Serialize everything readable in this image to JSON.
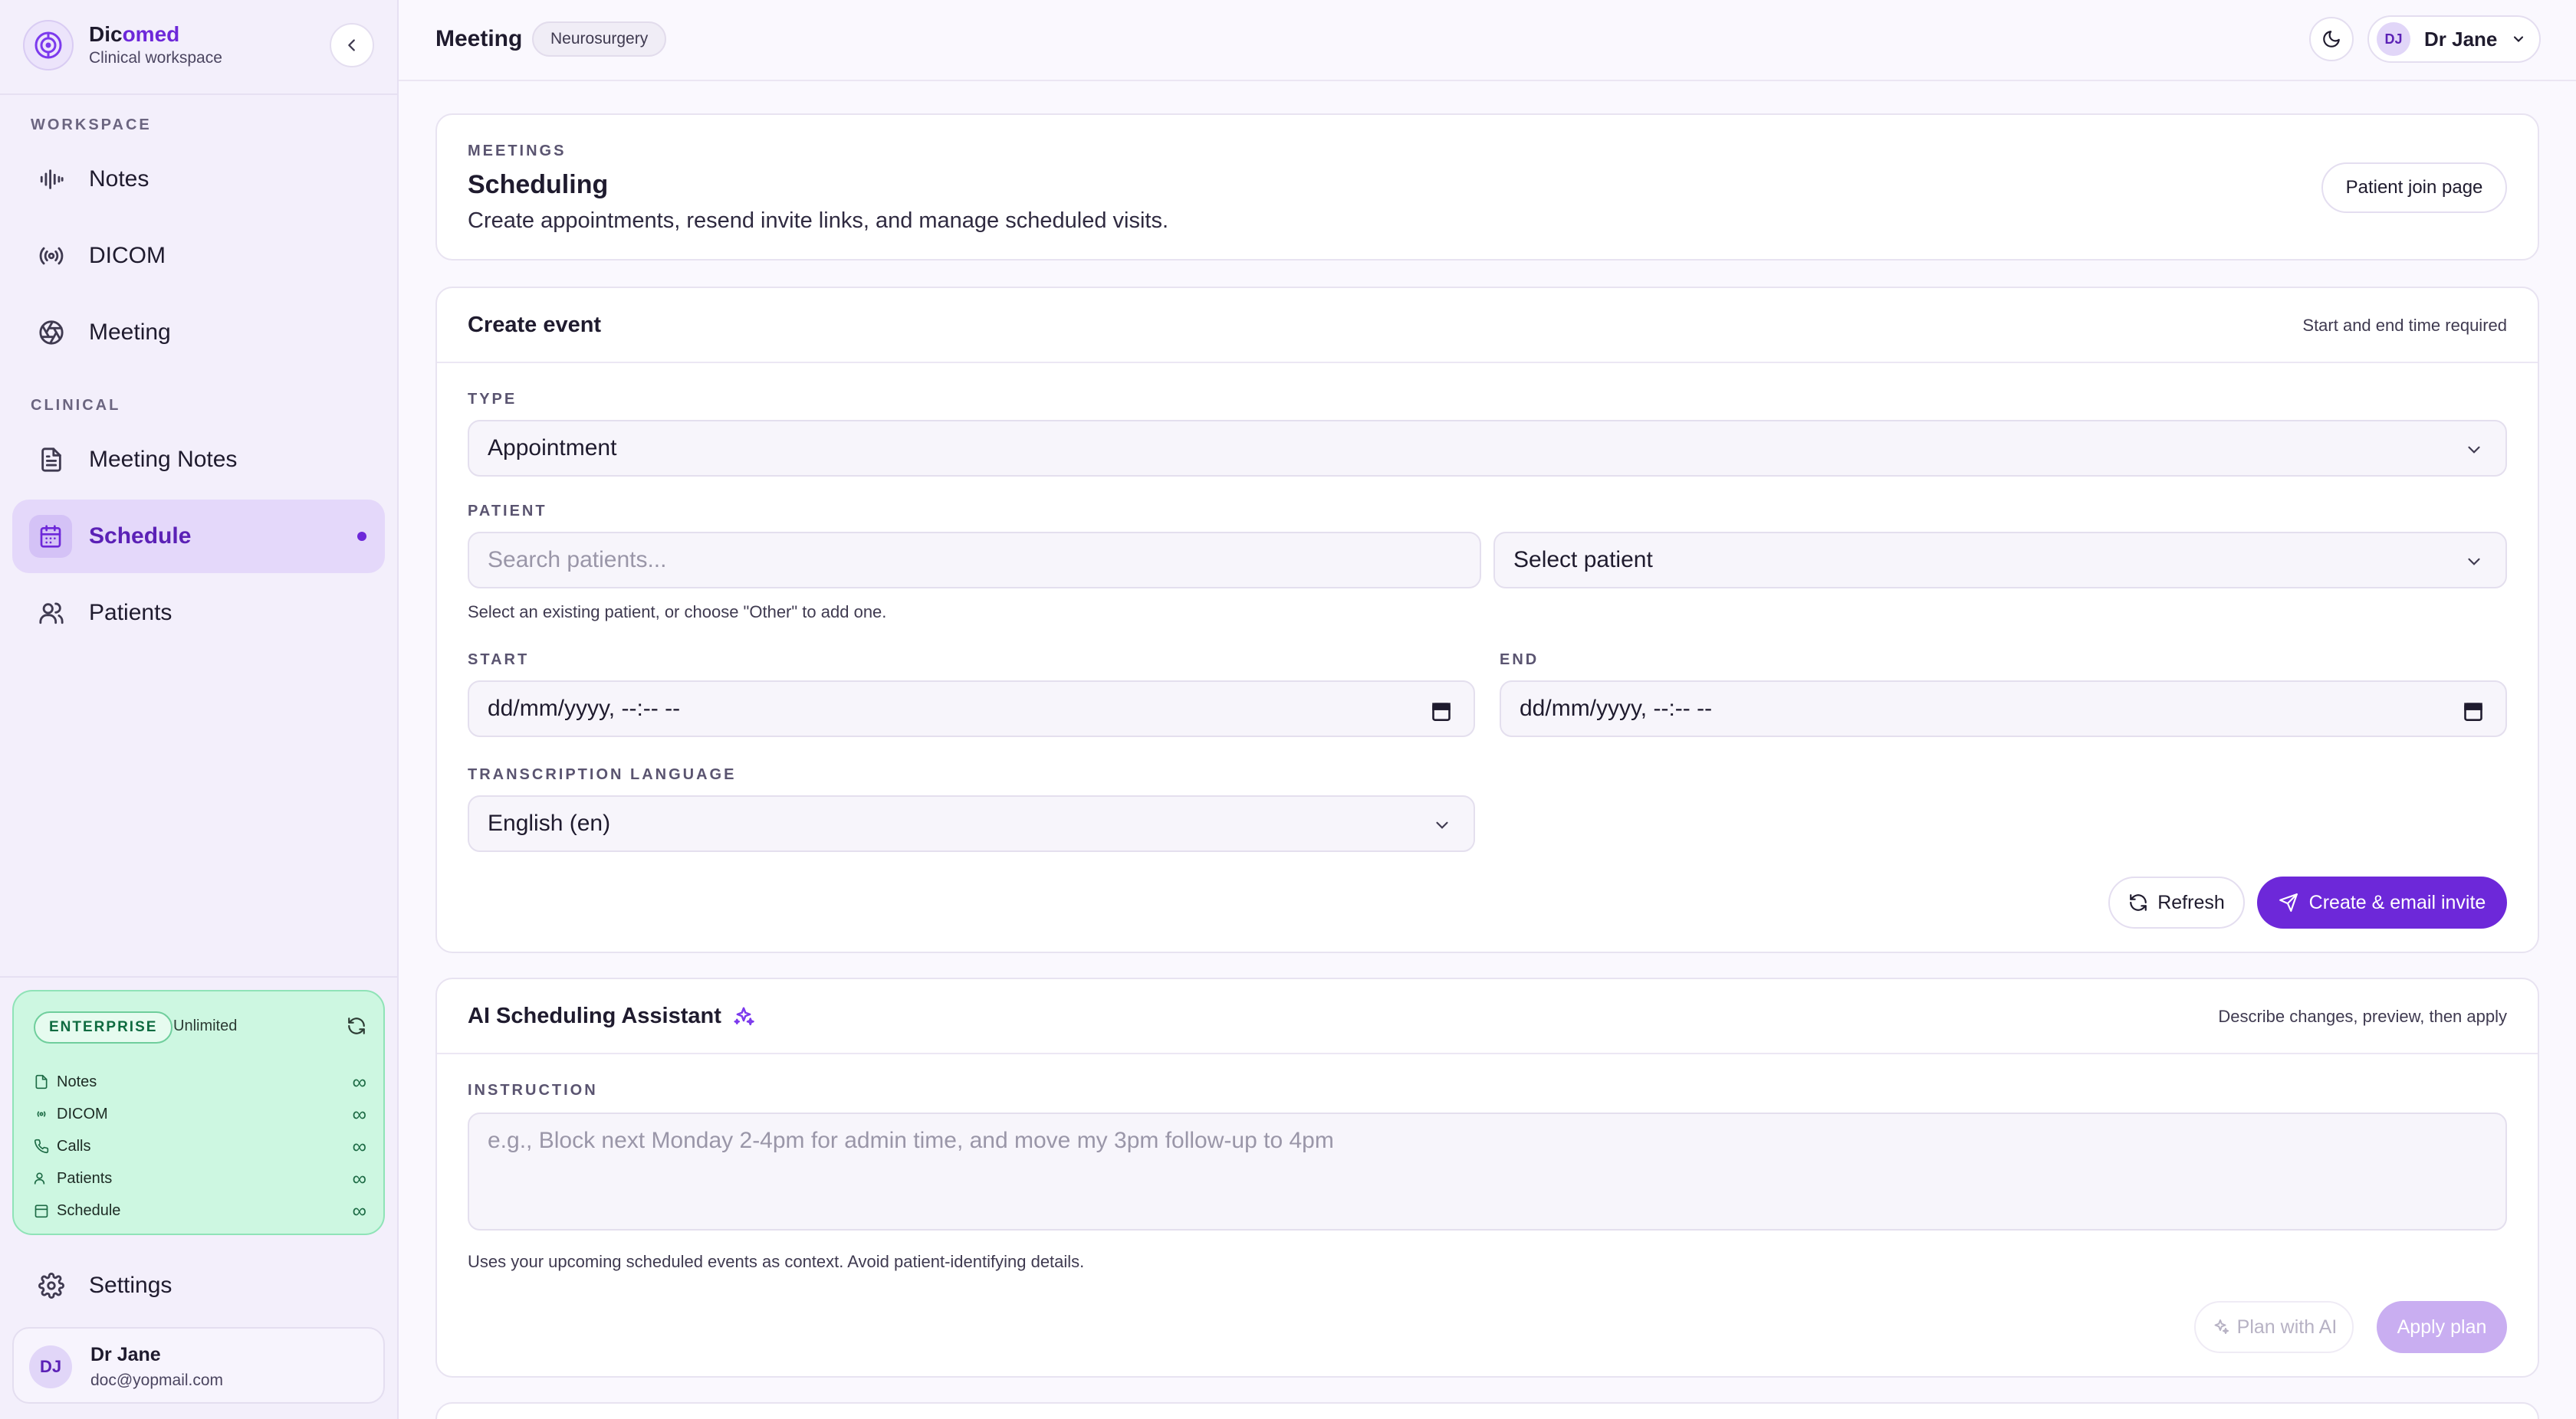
{
  "brand": {
    "name_part1": "Dic",
    "name_part2": "omed",
    "subtitle": "Clinical workspace"
  },
  "sidebar": {
    "workspace_label": "WORKSPACE",
    "clinical_label": "CLINICAL",
    "workspace_items": [
      {
        "label": "Notes",
        "icon": "waveform-icon"
      },
      {
        "label": "DICOM",
        "icon": "broadcast-icon"
      },
      {
        "label": "Meeting",
        "icon": "aperture-icon"
      }
    ],
    "clinical_items": [
      {
        "label": "Meeting Notes",
        "icon": "document-icon"
      },
      {
        "label": "Schedule",
        "icon": "calendar-icon",
        "active": true
      },
      {
        "label": "Patients",
        "icon": "users-icon"
      }
    ],
    "settings_label": "Settings"
  },
  "plan": {
    "badge": "ENTERPRISE",
    "quota": "Unlimited",
    "rows": [
      {
        "label": "Notes",
        "value": "∞"
      },
      {
        "label": "DICOM",
        "value": "∞"
      },
      {
        "label": "Calls",
        "value": "∞"
      },
      {
        "label": "Patients",
        "value": "∞"
      },
      {
        "label": "Schedule",
        "value": "∞"
      }
    ]
  },
  "user": {
    "initials": "DJ",
    "name": "Dr Jane",
    "email": "doc@yopmail.com"
  },
  "topbar": {
    "title": "Meeting",
    "badge": "Neurosurgery",
    "user_initials": "DJ",
    "user_name": "Dr Jane"
  },
  "header_card": {
    "eyebrow": "MEETINGS",
    "title": "Scheduling",
    "description": "Create appointments, resend invite links, and manage scheduled visits.",
    "join_button": "Patient join page"
  },
  "create_event": {
    "title": "Create event",
    "hint": "Start and end time required",
    "type_label": "TYPE",
    "type_value": "Appointment",
    "patient_label": "PATIENT",
    "patient_search_placeholder": "Search patients...",
    "patient_select_value": "Select patient",
    "patient_helper": "Select an existing patient, or choose \"Other\" to add one.",
    "start_label": "START",
    "start_value": "dd/mm/yyyy, --:-- --",
    "end_label": "END",
    "end_value": "dd/mm/yyyy, --:-- --",
    "language_label": "TRANSCRIPTION LANGUAGE",
    "language_value": "English (en)",
    "refresh_button": "Refresh",
    "create_button": "Create & email invite"
  },
  "ai_assistant": {
    "title": "AI Scheduling Assistant",
    "hint": "Describe changes, preview, then apply",
    "instruction_label": "INSTRUCTION",
    "instruction_placeholder": "e.g., Block next Monday 2-4pm for admin time, and move my 3pm follow-up to 4pm",
    "helper": "Uses your upcoming scheduled events as context. Avoid patient-identifying details.",
    "plan_button": "Plan with AI",
    "apply_button": "Apply plan"
  },
  "colors": {
    "accent": "#6d28d9",
    "sidebar_bg": "#f3effb",
    "plan_card_bg": "#cdf7e1"
  }
}
